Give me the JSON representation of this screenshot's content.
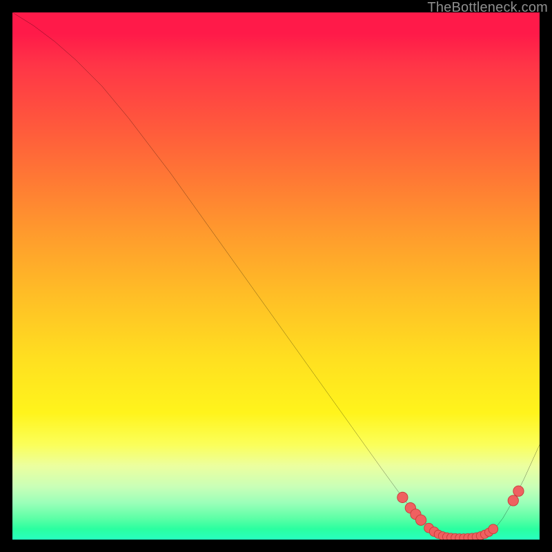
{
  "watermark": "TheBottleneck.com",
  "colors": {
    "curve": "#000000",
    "dot_fill": "#ef6060",
    "dot_stroke": "#c83a3a",
    "background": "#000000"
  },
  "chart_data": {
    "type": "line",
    "title": "",
    "xlabel": "",
    "ylabel": "",
    "xlim": [
      0,
      100
    ],
    "ylim": [
      0,
      100
    ],
    "grid": false,
    "legend": false,
    "series": [
      {
        "name": "bottleneck-curve",
        "x": [
          0,
          4,
          8,
          12,
          17,
          22,
          30,
          40,
          50,
          60,
          70,
          74,
          76,
          78,
          79,
          80,
          81,
          82,
          83,
          84,
          85,
          86,
          87,
          88,
          89,
          90,
          91,
          92,
          93,
          95,
          97,
          100
        ],
        "y": [
          100,
          97.5,
          94.5,
          91,
          86,
          80,
          69.5,
          55.5,
          41.5,
          27.5,
          13.5,
          8,
          5.5,
          3.5,
          2.6,
          1.9,
          1.3,
          0.9,
          0.6,
          0.4,
          0.3,
          0.3,
          0.3,
          0.4,
          0.6,
          1.0,
          1.7,
          2.7,
          4.0,
          7.4,
          11.4,
          18
        ]
      }
    ],
    "markers": [
      {
        "x": 74.0,
        "y": 8.0,
        "r": 1.0
      },
      {
        "x": 75.5,
        "y": 6.0,
        "r": 1.0
      },
      {
        "x": 76.5,
        "y": 4.8,
        "r": 1.0
      },
      {
        "x": 77.5,
        "y": 3.7,
        "r": 1.0
      },
      {
        "x": 79.0,
        "y": 2.2,
        "r": 0.9
      },
      {
        "x": 80.0,
        "y": 1.5,
        "r": 0.9
      },
      {
        "x": 80.8,
        "y": 1.0,
        "r": 0.8
      },
      {
        "x": 81.6,
        "y": 0.7,
        "r": 0.8
      },
      {
        "x": 82.4,
        "y": 0.5,
        "r": 0.8
      },
      {
        "x": 83.2,
        "y": 0.4,
        "r": 0.8
      },
      {
        "x": 84.0,
        "y": 0.35,
        "r": 0.8
      },
      {
        "x": 84.8,
        "y": 0.3,
        "r": 0.8
      },
      {
        "x": 85.6,
        "y": 0.3,
        "r": 0.8
      },
      {
        "x": 86.4,
        "y": 0.35,
        "r": 0.8
      },
      {
        "x": 87.2,
        "y": 0.4,
        "r": 0.8
      },
      {
        "x": 88.0,
        "y": 0.5,
        "r": 0.8
      },
      {
        "x": 88.8,
        "y": 0.7,
        "r": 0.8
      },
      {
        "x": 89.6,
        "y": 1.0,
        "r": 0.8
      },
      {
        "x": 90.4,
        "y": 1.4,
        "r": 0.8
      },
      {
        "x": 91.2,
        "y": 2.0,
        "r": 0.9
      },
      {
        "x": 95.0,
        "y": 7.4,
        "r": 1.0
      },
      {
        "x": 96.0,
        "y": 9.2,
        "r": 1.0
      }
    ]
  }
}
